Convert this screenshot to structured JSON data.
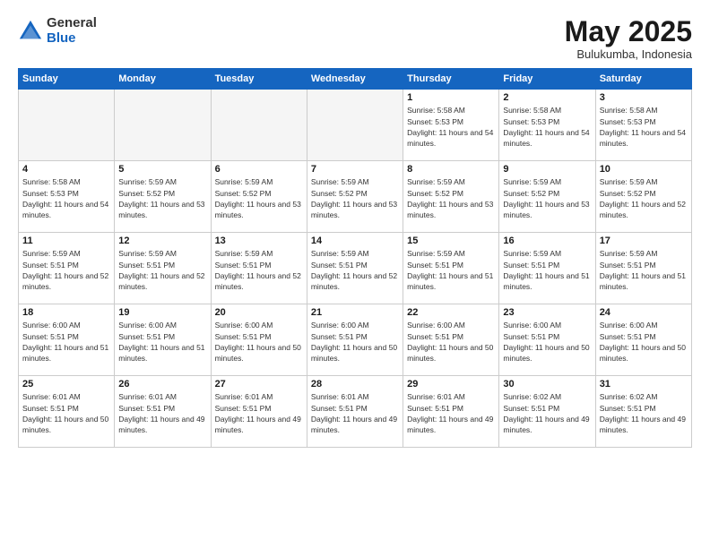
{
  "logo": {
    "general": "General",
    "blue": "Blue"
  },
  "header": {
    "month": "May 2025",
    "location": "Bulukumba, Indonesia"
  },
  "weekdays": [
    "Sunday",
    "Monday",
    "Tuesday",
    "Wednesday",
    "Thursday",
    "Friday",
    "Saturday"
  ],
  "weeks": [
    [
      {
        "day": "",
        "empty": true
      },
      {
        "day": "",
        "empty": true
      },
      {
        "day": "",
        "empty": true
      },
      {
        "day": "",
        "empty": true
      },
      {
        "day": "1",
        "sunrise": "5:58 AM",
        "sunset": "5:53 PM",
        "daylight": "11 hours and 54 minutes."
      },
      {
        "day": "2",
        "sunrise": "5:58 AM",
        "sunset": "5:53 PM",
        "daylight": "11 hours and 54 minutes."
      },
      {
        "day": "3",
        "sunrise": "5:58 AM",
        "sunset": "5:53 PM",
        "daylight": "11 hours and 54 minutes."
      }
    ],
    [
      {
        "day": "4",
        "sunrise": "5:58 AM",
        "sunset": "5:53 PM",
        "daylight": "11 hours and 54 minutes."
      },
      {
        "day": "5",
        "sunrise": "5:59 AM",
        "sunset": "5:52 PM",
        "daylight": "11 hours and 53 minutes."
      },
      {
        "day": "6",
        "sunrise": "5:59 AM",
        "sunset": "5:52 PM",
        "daylight": "11 hours and 53 minutes."
      },
      {
        "day": "7",
        "sunrise": "5:59 AM",
        "sunset": "5:52 PM",
        "daylight": "11 hours and 53 minutes."
      },
      {
        "day": "8",
        "sunrise": "5:59 AM",
        "sunset": "5:52 PM",
        "daylight": "11 hours and 53 minutes."
      },
      {
        "day": "9",
        "sunrise": "5:59 AM",
        "sunset": "5:52 PM",
        "daylight": "11 hours and 53 minutes."
      },
      {
        "day": "10",
        "sunrise": "5:59 AM",
        "sunset": "5:52 PM",
        "daylight": "11 hours and 52 minutes."
      }
    ],
    [
      {
        "day": "11",
        "sunrise": "5:59 AM",
        "sunset": "5:51 PM",
        "daylight": "11 hours and 52 minutes."
      },
      {
        "day": "12",
        "sunrise": "5:59 AM",
        "sunset": "5:51 PM",
        "daylight": "11 hours and 52 minutes."
      },
      {
        "day": "13",
        "sunrise": "5:59 AM",
        "sunset": "5:51 PM",
        "daylight": "11 hours and 52 minutes."
      },
      {
        "day": "14",
        "sunrise": "5:59 AM",
        "sunset": "5:51 PM",
        "daylight": "11 hours and 52 minutes."
      },
      {
        "day": "15",
        "sunrise": "5:59 AM",
        "sunset": "5:51 PM",
        "daylight": "11 hours and 51 minutes."
      },
      {
        "day": "16",
        "sunrise": "5:59 AM",
        "sunset": "5:51 PM",
        "daylight": "11 hours and 51 minutes."
      },
      {
        "day": "17",
        "sunrise": "5:59 AM",
        "sunset": "5:51 PM",
        "daylight": "11 hours and 51 minutes."
      }
    ],
    [
      {
        "day": "18",
        "sunrise": "6:00 AM",
        "sunset": "5:51 PM",
        "daylight": "11 hours and 51 minutes."
      },
      {
        "day": "19",
        "sunrise": "6:00 AM",
        "sunset": "5:51 PM",
        "daylight": "11 hours and 51 minutes."
      },
      {
        "day": "20",
        "sunrise": "6:00 AM",
        "sunset": "5:51 PM",
        "daylight": "11 hours and 50 minutes."
      },
      {
        "day": "21",
        "sunrise": "6:00 AM",
        "sunset": "5:51 PM",
        "daylight": "11 hours and 50 minutes."
      },
      {
        "day": "22",
        "sunrise": "6:00 AM",
        "sunset": "5:51 PM",
        "daylight": "11 hours and 50 minutes."
      },
      {
        "day": "23",
        "sunrise": "6:00 AM",
        "sunset": "5:51 PM",
        "daylight": "11 hours and 50 minutes."
      },
      {
        "day": "24",
        "sunrise": "6:00 AM",
        "sunset": "5:51 PM",
        "daylight": "11 hours and 50 minutes."
      }
    ],
    [
      {
        "day": "25",
        "sunrise": "6:01 AM",
        "sunset": "5:51 PM",
        "daylight": "11 hours and 50 minutes."
      },
      {
        "day": "26",
        "sunrise": "6:01 AM",
        "sunset": "5:51 PM",
        "daylight": "11 hours and 49 minutes."
      },
      {
        "day": "27",
        "sunrise": "6:01 AM",
        "sunset": "5:51 PM",
        "daylight": "11 hours and 49 minutes."
      },
      {
        "day": "28",
        "sunrise": "6:01 AM",
        "sunset": "5:51 PM",
        "daylight": "11 hours and 49 minutes."
      },
      {
        "day": "29",
        "sunrise": "6:01 AM",
        "sunset": "5:51 PM",
        "daylight": "11 hours and 49 minutes."
      },
      {
        "day": "30",
        "sunrise": "6:02 AM",
        "sunset": "5:51 PM",
        "daylight": "11 hours and 49 minutes."
      },
      {
        "day": "31",
        "sunrise": "6:02 AM",
        "sunset": "5:51 PM",
        "daylight": "11 hours and 49 minutes."
      }
    ]
  ]
}
